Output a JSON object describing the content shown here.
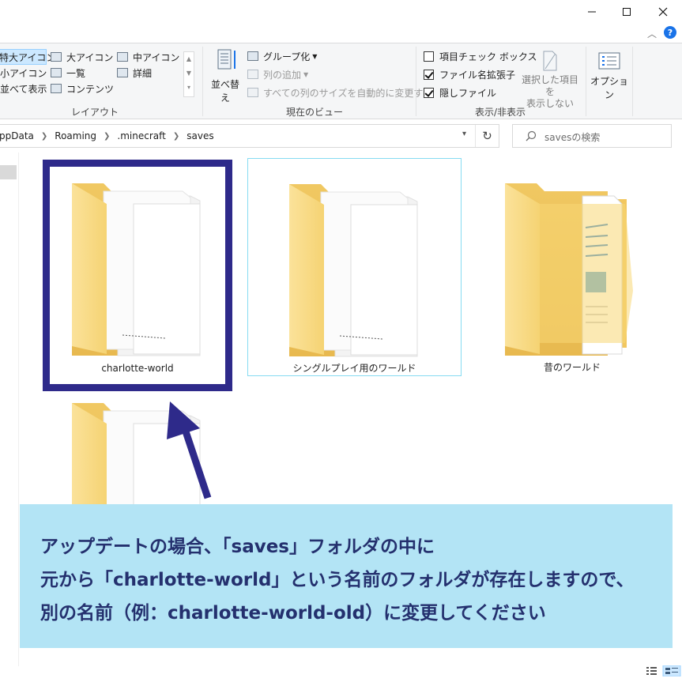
{
  "window": {
    "min_icon": "minimize-icon",
    "max_icon": "maximize-icon",
    "close_icon": "close-icon",
    "help_label": "?"
  },
  "ribbon": {
    "layout": {
      "group_label": "レイアウト",
      "items": [
        {
          "label": "特大アイコン",
          "selected": true
        },
        {
          "label": "大アイコン"
        },
        {
          "label": "中アイコン"
        },
        {
          "label": "小アイコン"
        },
        {
          "label": "一覧"
        },
        {
          "label": "詳細"
        },
        {
          "label": "並べて表示"
        },
        {
          "label": "コンテンツ"
        }
      ]
    },
    "current_view": {
      "group_label": "現在のビュー",
      "sort_label": "並べ替え",
      "group_by_label": "グループ化",
      "add_column_label": "列の追加",
      "fit_columns_label": "すべての列のサイズを自動的に変更する"
    },
    "show_hide": {
      "group_label": "表示/非表示",
      "item_checkbox_label": "項目チェック ボックス",
      "item_checkbox_checked": false,
      "file_ext_label": "ファイル名拡張子",
      "file_ext_checked": true,
      "hidden_files_label": "隠しファイル",
      "hidden_files_checked": true,
      "hide_selected_label_1": "選択した項目を",
      "hide_selected_label_2": "表示しない"
    },
    "options_label": "オプション"
  },
  "address": {
    "crumbs": [
      "ppData",
      "Roaming",
      ".minecraft",
      "saves"
    ],
    "search_placeholder": "savesの検索"
  },
  "folders": [
    {
      "name": "charlotte-world",
      "state": "highlighted"
    },
    {
      "name": "シングルプレイ用のワールド",
      "state": "hover"
    },
    {
      "name": "昔のワールド",
      "state": "normal"
    },
    {
      "name": "",
      "state": "partial"
    }
  ],
  "callout": {
    "line1": "アップデートの場合、「saves」フォルダの中に",
    "line2": "元から「charlotte-world」という名前のフォルダが存在しますので、",
    "line3": "別の名前（例：charlotte-world-old）に変更してください",
    "bg_color": "#b3e4f5",
    "text_color": "#24306e"
  },
  "colors": {
    "highlight_border": "#2e2a8a",
    "hover_border": "#86dbf2",
    "folder_yellow": "#f8d775"
  }
}
